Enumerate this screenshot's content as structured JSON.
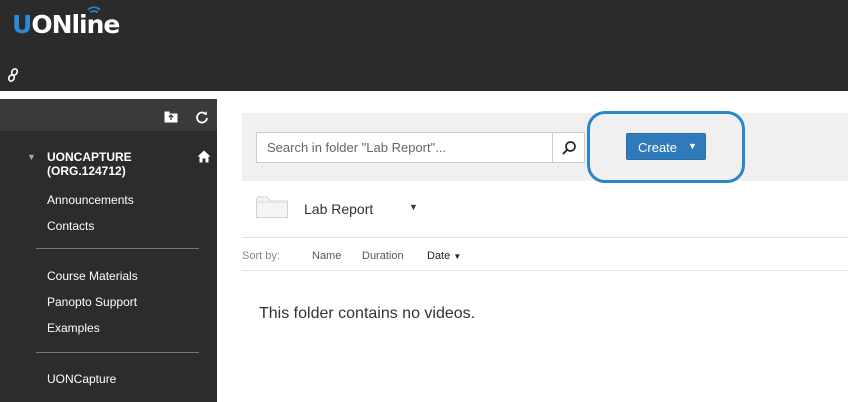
{
  "header": {
    "logo_u": "U",
    "logo_rest": "ONline",
    "colors": {
      "background": "#2b2b2b",
      "logo_accent": "#2a8ad4"
    },
    "icons": [
      "wifi-arc-icon",
      "link-icon"
    ]
  },
  "sidebar": {
    "toolbar_icons": [
      "folder-up-icon",
      "refresh-icon"
    ],
    "course": {
      "name_line1": "UONCAPTURE",
      "name_line2": "(ORG.124712)",
      "icons": [
        "collapse-arrow-icon",
        "home-icon"
      ]
    },
    "groups": [
      [
        "Announcements",
        "Contacts"
      ],
      [
        "Course Materials",
        "Panopto Support",
        "Examples"
      ],
      [
        "UONCapture"
      ]
    ]
  },
  "main": {
    "search": {
      "placeholder": "Search in folder \"Lab Report\"...",
      "value": ""
    },
    "create_label": "Create",
    "create_caret": "▼",
    "folder": {
      "name": "Lab Report",
      "caret": "▼"
    },
    "sort": {
      "label": "Sort by:",
      "options": [
        "Name",
        "Duration",
        "Date"
      ],
      "active": "Date",
      "active_caret": "▼"
    },
    "empty_message": "This folder contains no videos.",
    "colors": {
      "create_button": "#2f7ab8",
      "highlight_ring": "#2a86c8"
    }
  }
}
